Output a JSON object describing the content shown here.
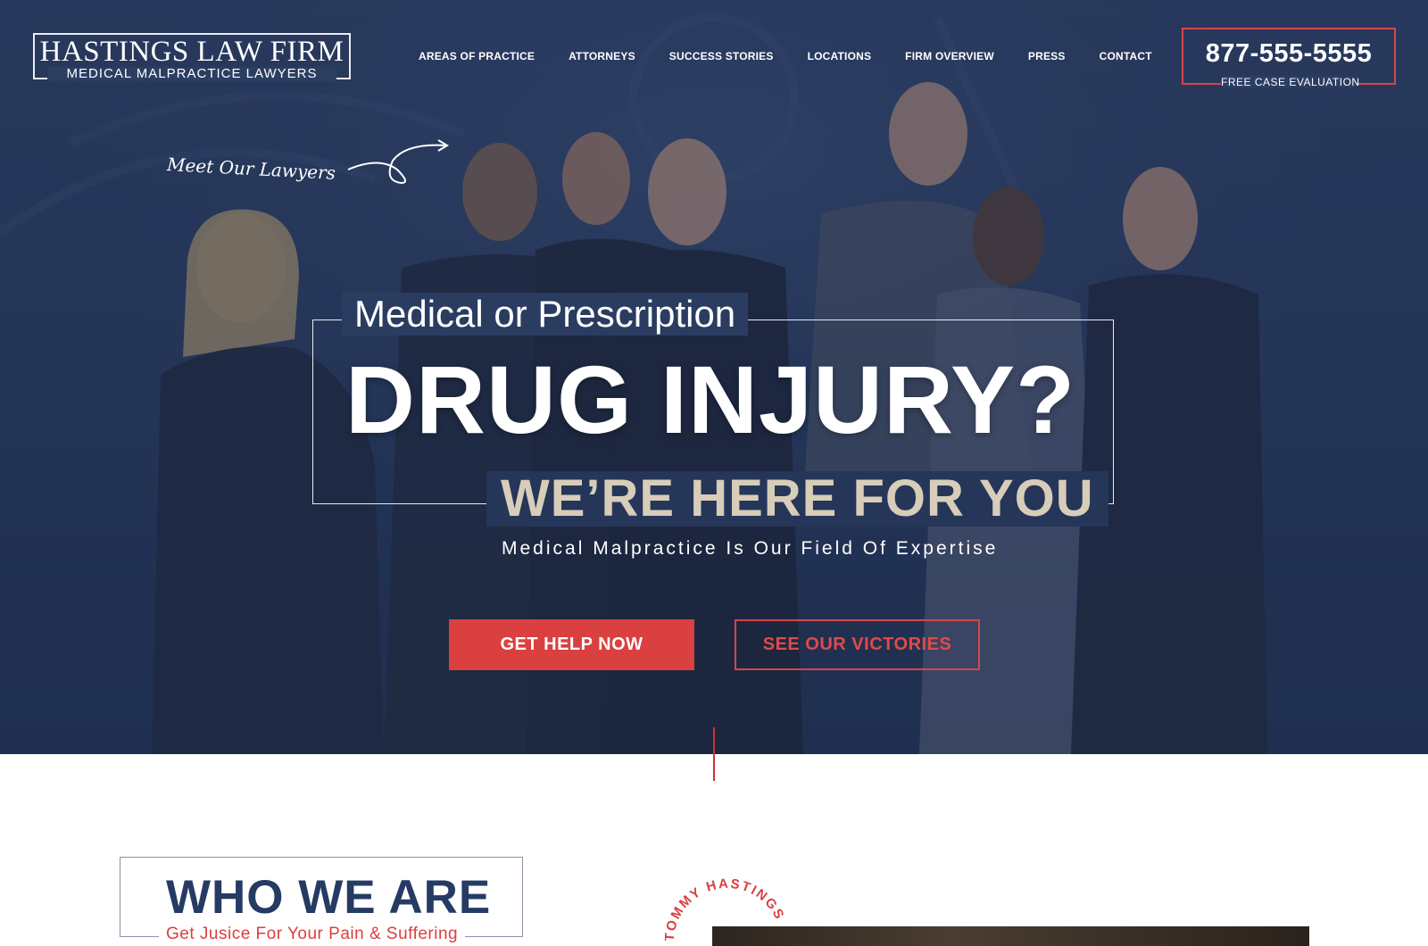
{
  "brand": {
    "name": "HASTINGS LAW FIRM",
    "tagline": "MEDICAL MALPRACTICE LAWYERS"
  },
  "nav": {
    "items": [
      "AREAS OF PRACTICE",
      "ATTORNEYS",
      "SUCCESS STORIES",
      "LOCATIONS",
      "FIRM OVERVIEW",
      "PRESS",
      "CONTACT"
    ]
  },
  "phone": {
    "number": "877-555-5555",
    "cta": "FREE CASE EVALUATION"
  },
  "hero": {
    "meet_lawyers": "Meet Our Lawyers",
    "subheading": "Medical or Prescription",
    "heading": "DRUG INJURY?",
    "tagline": "WE’RE HERE FOR YOU",
    "expertise": "Medical Malpractice Is Our Field Of Expertise",
    "primary_button": "GET HELP NOW",
    "secondary_button": "SEE OUR VICTORIES"
  },
  "about": {
    "title": "WHO WE ARE",
    "subtitle": "Get Jusice For Your Pain & Suffering",
    "stamp_text": "TOMMY HASTINGS"
  },
  "colors": {
    "navy": "#26385a",
    "accent_red": "#d9403f",
    "tan": "#d8cdb9",
    "title_blue": "#253b64"
  }
}
